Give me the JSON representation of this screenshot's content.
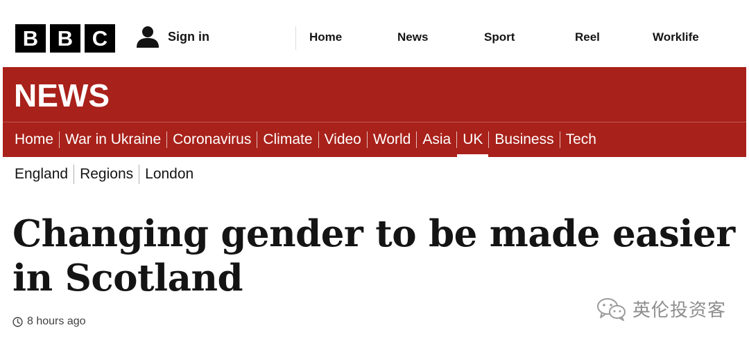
{
  "brand": {
    "logo_letters": [
      "B",
      "B",
      "C"
    ]
  },
  "account": {
    "signin_label": "Sign in",
    "icon": "user-icon"
  },
  "top_nav": {
    "items": [
      "Home",
      "News",
      "Sport",
      "Reel",
      "Worklife"
    ]
  },
  "section": {
    "title": "NEWS",
    "color": "#a8211a"
  },
  "section_nav": {
    "items": [
      "Home",
      "War in Ukraine",
      "Coronavirus",
      "Climate",
      "Video",
      "World",
      "Asia",
      "UK",
      "Business",
      "Tech"
    ],
    "active": "UK"
  },
  "sub_nav": {
    "items": [
      "England",
      "Regions",
      "London"
    ]
  },
  "article": {
    "headline": "Changing gender to be made easier in Scotland",
    "timestamp": "8 hours ago",
    "timestamp_icon": "clock-icon"
  },
  "watermark": {
    "text": "英伦投资客",
    "icon": "wechat-icon"
  }
}
